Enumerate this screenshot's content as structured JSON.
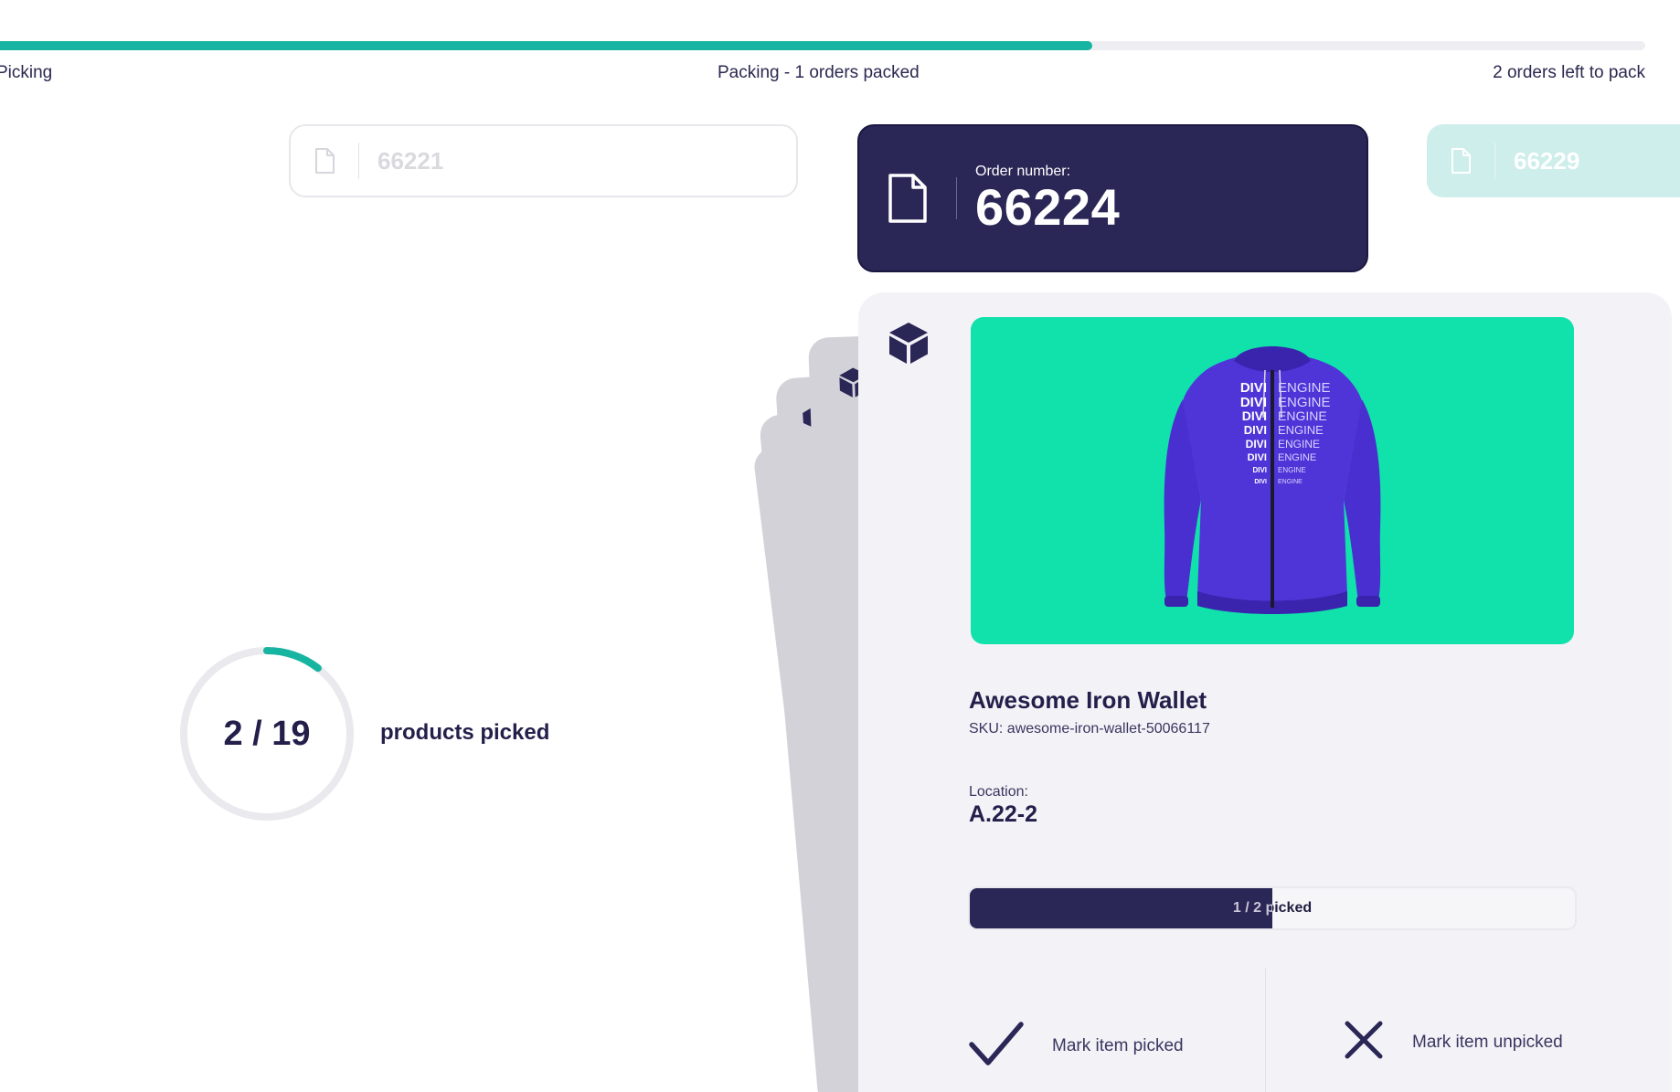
{
  "header": {
    "progress_fraction": 0.664,
    "step_picking": "Picking",
    "step_packing": "Packing - 1 orders packed",
    "step_remaining": "2 orders left to pack",
    "accent_color": "#17b5a1"
  },
  "orders": {
    "previous": {
      "number": "66221",
      "icon": "document-icon"
    },
    "current": {
      "label": "Order number:",
      "number": "66224",
      "icon": "document-icon"
    },
    "next": {
      "number": "66229",
      "icon": "document-icon"
    }
  },
  "summary": {
    "picked": 2,
    "total": 19,
    "ratio_text": "2 / 19",
    "caption": "products picked"
  },
  "product": {
    "icon": "cube-icon",
    "image_bg": "#11e1ab",
    "image_print": [
      "DIVI",
      "ENGINE"
    ],
    "name": "Awesome Iron Wallet",
    "sku": "SKU: awesome-iron-wallet-50066117",
    "location_label": "Location:",
    "location_value": "A.22-2",
    "pick_fraction": 0.5,
    "pick_status": "1 / 2 picked",
    "actions": {
      "mark_picked": "Mark item picked",
      "mark_unpicked": "Mark item unpicked"
    }
  }
}
